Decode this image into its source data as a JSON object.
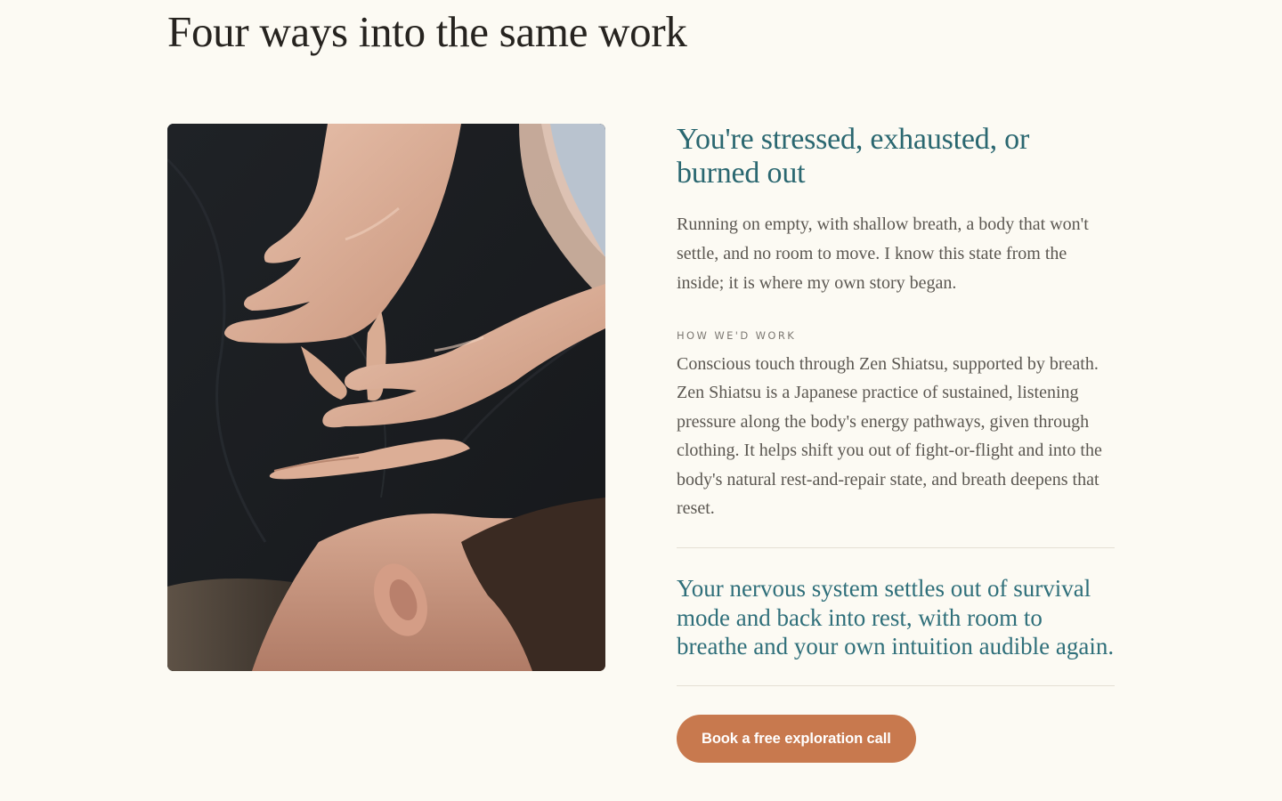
{
  "section": {
    "title": "Four ways into the same work"
  },
  "case": {
    "photo_icon": "massage-photo",
    "heading": "You're stressed, exhausted, or burned out",
    "body": "Running on empty, with shallow breath, a body that won't settle, and no room to move. I know this state from the inside; it is where my own story began.",
    "approach_label": "HOW WE'D WORK",
    "approach_text": "Conscious touch through Zen Shiatsu, supported by breath. Zen Shiatsu is a Japanese practice of sustained, listening pressure along the body's energy pathways, given through clothing. It helps shift you out of fight-or-flight and into the body's natural rest-and-repair state, and breath deepens that reset.",
    "outcome": "Your nervous system settles out of survival mode and back into rest, with room to breathe and your own intuition audible again.",
    "cta_label": "Book a free exploration call"
  },
  "colors": {
    "background": "#fcfaf3",
    "heading_teal": "#2a6770",
    "outcome_teal": "#2f6f7a",
    "cta": "#c8794e"
  }
}
